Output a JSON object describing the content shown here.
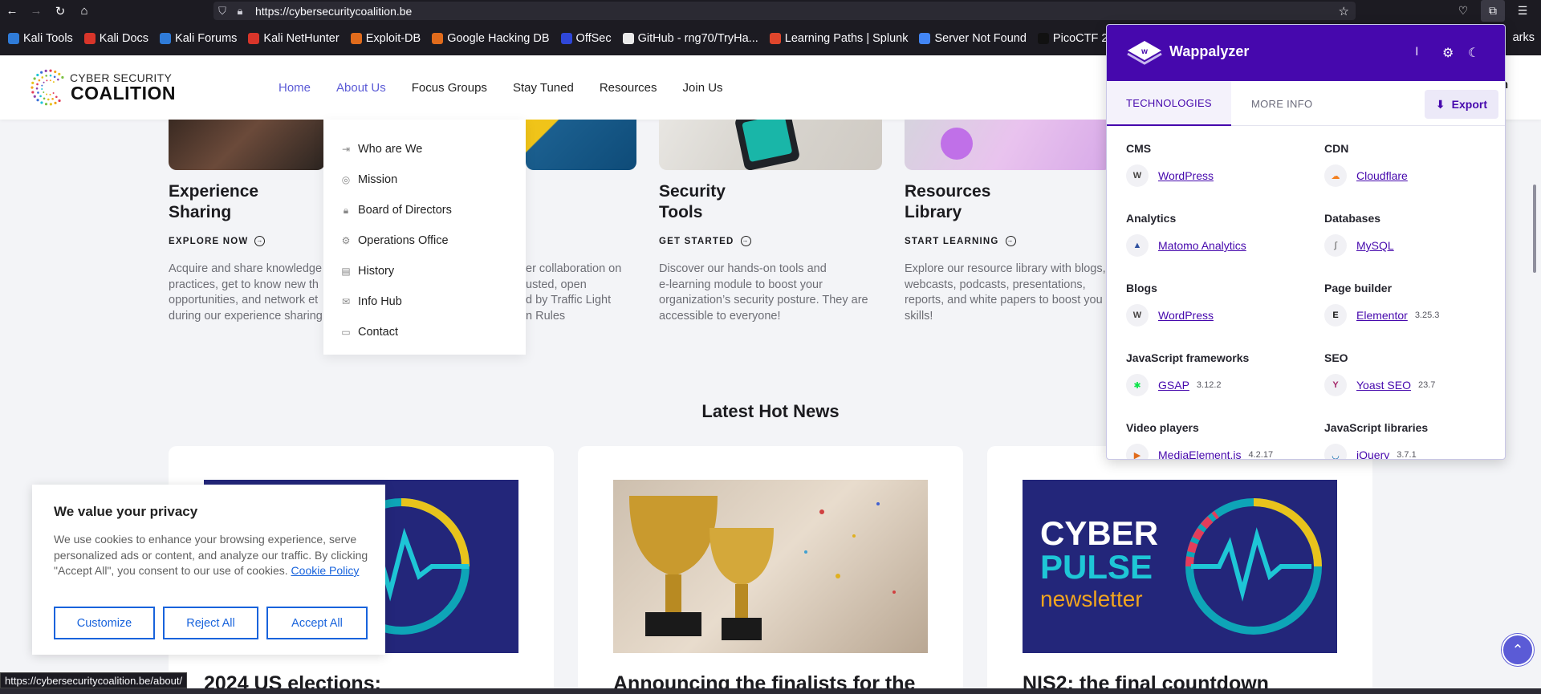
{
  "browser": {
    "url": "https://cybersecuritycoalition.be",
    "status_url": "https://cybersecuritycoalition.be/about/",
    "bookmarks": [
      {
        "label": "Kali Tools",
        "color": "#2f7bd8"
      },
      {
        "label": "Kali Docs",
        "color": "#d8352a"
      },
      {
        "label": "Kali Forums",
        "color": "#2f7bd8"
      },
      {
        "label": "Kali NetHunter",
        "color": "#d8352a"
      },
      {
        "label": "Exploit-DB",
        "color": "#e06b1c"
      },
      {
        "label": "Google Hacking DB",
        "color": "#e06b1c"
      },
      {
        "label": "OffSec",
        "color": "#2f47d8"
      },
      {
        "label": "GitHub - rng70/TryHa...",
        "color": "#eaeaea"
      },
      {
        "label": "Learning Paths | Splunk",
        "color": "#e0462c"
      },
      {
        "label": "Server Not Found",
        "color": "#4285f4"
      },
      {
        "label": "PicoCTF 2",
        "color": "#111111"
      }
    ],
    "bookmarks_tail": "arks"
  },
  "site": {
    "logo_line1": "CYBER SECURITY",
    "logo_line2": "COALITION",
    "nav": [
      "Home",
      "About Us",
      "Focus Groups",
      "Stay Tuned",
      "Resources",
      "Join Us"
    ],
    "header_tail": "n",
    "dropdown": [
      {
        "label": "Who are We",
        "icon": "login-icon"
      },
      {
        "label": "Mission",
        "icon": "target-icon"
      },
      {
        "label": "Board of Directors",
        "icon": "lock-icon"
      },
      {
        "label": "Operations Office",
        "icon": "gear-icon"
      },
      {
        "label": "History",
        "icon": "document-icon"
      },
      {
        "label": "Info Hub",
        "icon": "inbox-icon"
      },
      {
        "label": "Contact",
        "icon": "chat-icon"
      }
    ],
    "cards": [
      {
        "title_l1": "Experience",
        "title_l2": "Sharing",
        "link": "EXPLORE NOW",
        "text": [
          "Acquire and share knowledge",
          "practices, get to know new th",
          "opportunities, and network et",
          "during our experience sharing"
        ]
      },
      {
        "title_l1": "",
        "title_l2": "",
        "link": "",
        "text": [
          "er collaboration on",
          "usted, open",
          "d by Traffic Light",
          "n Rules"
        ]
      },
      {
        "title_l1": "Security",
        "title_l2": "Tools",
        "link": "GET STARTED",
        "text": [
          "Discover our hands-on tools and",
          "e-learning module to boost your",
          "organization’s security posture. They are",
          "accessible to everyone!"
        ]
      },
      {
        "title_l1": "Resources",
        "title_l2": "Library",
        "link": "START LEARNING",
        "text": [
          "Explore our resource library with blogs,",
          "webcasts, podcasts, presentations,",
          "reports, and white papers to boost you",
          "skills!"
        ]
      }
    ],
    "news_heading": "Latest Hot News",
    "news": [
      {
        "title": "2024 US elections:",
        "img": "cyber-pulse"
      },
      {
        "title": "Announcing the finalists for the",
        "img": "trophies"
      },
      {
        "title": "NIS2: the final countdown",
        "img": "cyber-pulse-newsletter",
        "img_text": [
          "CYBER",
          "PULSE",
          "newsletter"
        ]
      }
    ]
  },
  "wappalyzer": {
    "name": "Wappalyzer",
    "tabs": [
      "TECHNOLOGIES",
      "MORE INFO"
    ],
    "export_label": "Export",
    "categories": [
      {
        "name": "CMS",
        "tech": "WordPress",
        "version": "",
        "icon": "wordpress-icon",
        "icon_glyph": "W",
        "icon_color": "#464342"
      },
      {
        "name": "CDN",
        "tech": "Cloudflare",
        "version": "",
        "icon": "cloudflare-icon",
        "icon_glyph": "☁",
        "icon_color": "#f38020"
      },
      {
        "name": "Analytics",
        "tech": "Matomo Analytics",
        "version": "",
        "icon": "matomo-icon",
        "icon_glyph": "▲",
        "icon_color": "#3152a0"
      },
      {
        "name": "Databases",
        "tech": "MySQL",
        "version": "",
        "icon": "mysql-icon",
        "icon_glyph": "∫",
        "icon_color": "#888888"
      },
      {
        "name": "Blogs",
        "tech": "WordPress",
        "version": "",
        "icon": "wordpress-icon",
        "icon_glyph": "W",
        "icon_color": "#464342"
      },
      {
        "name": "Page builder",
        "tech": "Elementor",
        "version": "3.25.3",
        "icon": "elementor-icon",
        "icon_glyph": "E",
        "icon_color": "#111111"
      },
      {
        "name": "JavaScript frameworks",
        "tech": "GSAP",
        "version": "3.12.2",
        "icon": "gsap-icon",
        "icon_glyph": "✱",
        "icon_color": "#0ae448"
      },
      {
        "name": "SEO",
        "tech": "Yoast SEO",
        "version": "23.7",
        "icon": "yoast-icon",
        "icon_glyph": "Y",
        "icon_color": "#a4286a"
      },
      {
        "name": "Video players",
        "tech": "MediaElement.js",
        "version": "4.2.17",
        "icon": "mediaelement-icon",
        "icon_glyph": "▶",
        "icon_color": "#e06b1c"
      },
      {
        "name": "JavaScript libraries",
        "tech": "jQuery",
        "version": "3.7.1",
        "icon": "jquery-icon",
        "icon_glyph": "◡",
        "icon_color": "#0769ad"
      }
    ]
  },
  "cookie": {
    "title": "We value your privacy",
    "text": "We use cookies to enhance your browsing experience, serve personalized ads or content, and analyze our traffic. By clicking \"Accept All\", you consent to our use of cookies.",
    "policy_link": "Cookie Policy",
    "buttons": [
      "Customize",
      "Reject All",
      "Accept All"
    ]
  }
}
